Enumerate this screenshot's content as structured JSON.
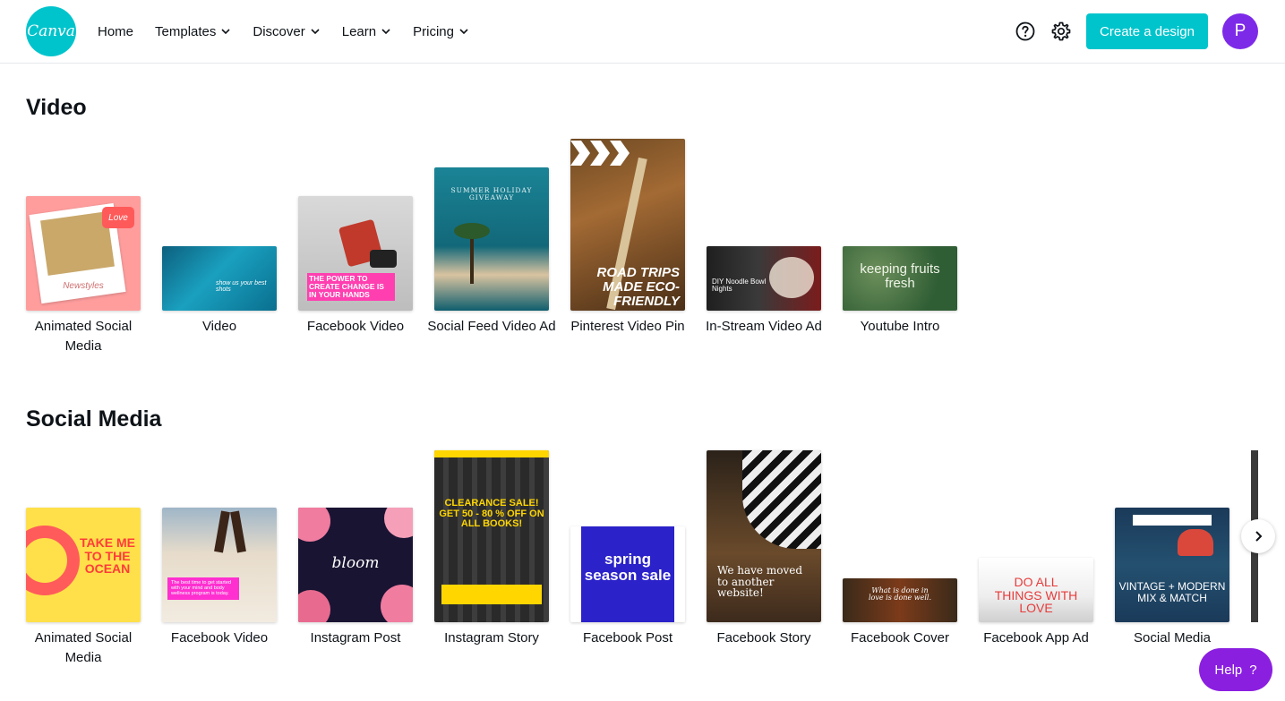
{
  "header": {
    "logo_text": "Canva",
    "nav": [
      {
        "label": "Home",
        "has_dropdown": false
      },
      {
        "label": "Templates",
        "has_dropdown": true
      },
      {
        "label": "Discover",
        "has_dropdown": true
      },
      {
        "label": "Learn",
        "has_dropdown": true
      },
      {
        "label": "Pricing",
        "has_dropdown": true
      }
    ],
    "help_icon": "question-circle-icon",
    "settings_icon": "gear-icon",
    "create_button": "Create a design",
    "avatar_initial": "P"
  },
  "sections": [
    {
      "title": "Video",
      "cards": [
        {
          "label": "Animated Social Media",
          "thumb_text": "Newstyles",
          "colors": [
            "#ff9a9a",
            "#fff0ee"
          ]
        },
        {
          "label": "Video",
          "thumb_text": "show us your best shots",
          "colors": [
            "#0a6f8f",
            "#1fa6c4"
          ]
        },
        {
          "label": "Facebook Video",
          "thumb_text": "THE POWER TO CREATE CHANGE IS IN YOUR HANDS",
          "colors": [
            "#cfcfcf",
            "#e9e9e9"
          ]
        },
        {
          "label": "Social Feed Video Ad",
          "thumb_text": "SUMMER HOLIDAY GIVEAWAY",
          "colors": [
            "#1b7f93",
            "#0f5e6e"
          ]
        },
        {
          "label": "Pinterest Video Pin",
          "thumb_text": "ROAD TRIPS MADE ECO-FRIENDLY",
          "colors": [
            "#8a5a2b",
            "#4a2f17"
          ]
        },
        {
          "label": "In-Stream Video Ad",
          "thumb_text": "DIY Noodle Bowl Nights",
          "colors": [
            "#2b2b2b",
            "#6b1a1a"
          ]
        },
        {
          "label": "Youtube Intro",
          "thumb_text": "keeping fruits fresh",
          "colors": [
            "#2f5d34",
            "#6c8f5b"
          ]
        }
      ]
    },
    {
      "title": "Social Media",
      "cards": [
        {
          "label": "Animated Social Media",
          "thumb_text": "TAKE ME TO THE OCEAN",
          "colors": [
            "#ffe04a",
            "#ff5b5b"
          ]
        },
        {
          "label": "Facebook Video",
          "thumb_text": "The best time to get started with your mind and body wellness program is today.",
          "colors": [
            "#d8cbb8",
            "#f2ebe0"
          ]
        },
        {
          "label": "Instagram Post",
          "thumb_text": "bloom",
          "colors": [
            "#1a1433",
            "#f07ca0"
          ]
        },
        {
          "label": "Instagram Story",
          "thumb_text": "CLEARANCE SALE! GET 50 - 80 % OFF ON ALL BOOKS!",
          "colors": [
            "#2f2f2f",
            "#ffd600"
          ]
        },
        {
          "label": "Facebook Post",
          "thumb_text": "spring season sale",
          "colors": [
            "#2b22c9",
            "#ffffff"
          ]
        },
        {
          "label": "Facebook Story",
          "thumb_text": "We have moved to another website!",
          "colors": [
            "#3d2a1c",
            "#7a5a3a"
          ]
        },
        {
          "label": "Facebook Cover",
          "thumb_text": "What is done in love is done well.",
          "colors": [
            "#3a2a1a",
            "#7c3b1a"
          ]
        },
        {
          "label": "Facebook App Ad",
          "thumb_text": "DO ALL THINGS WITH LOVE",
          "colors": [
            "#f5f5f5",
            "#e83b3b"
          ]
        },
        {
          "label": "Social Media",
          "thumb_text": "VINTAGE + MODERN MIX & MATCH",
          "colors": [
            "#1b3a5a",
            "#d9483b"
          ]
        }
      ]
    }
  ],
  "help_widget": {
    "label": "Help",
    "icon": "question-mark-icon"
  },
  "carousel_next_icon": "chevron-right-icon"
}
